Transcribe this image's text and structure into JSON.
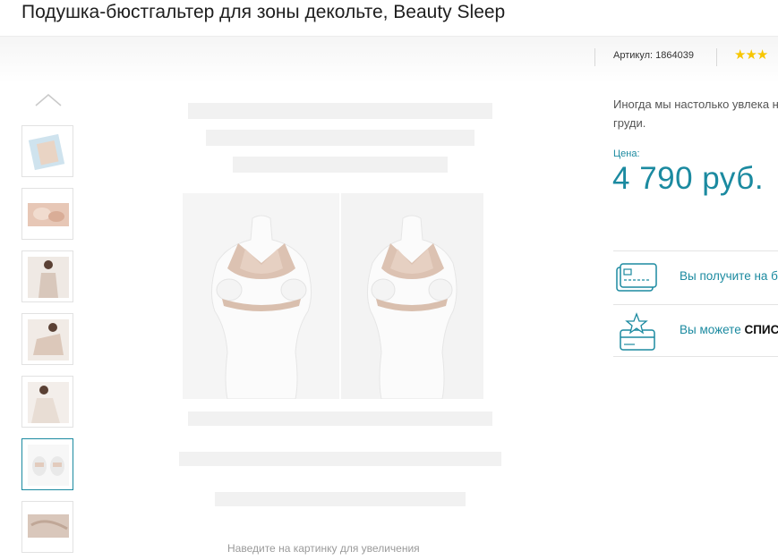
{
  "product": {
    "title": "Подушка-бюстгальтер для зоны декольте, Beauty Sleep",
    "article": "Артикул: 1864039",
    "rating_stars": "★★★"
  },
  "gallery": {
    "zoom_hint": "Наведите на картинку для увеличения",
    "thumbnails": [
      "thumb-package",
      "thumb-lifestyle-1",
      "thumb-model-1",
      "thumb-model-2",
      "thumb-model-3",
      "thumb-mannequins",
      "thumb-detail"
    ],
    "active_index": 5
  },
  "info": {
    "description": "Иногда мы настолько увлека на груди.",
    "price_label": "Цена:",
    "price": "4 790 руб."
  },
  "benefits": [
    {
      "icon": "card-icon",
      "text": "Вы получите на б"
    },
    {
      "icon": "star-card-icon",
      "text_prefix": "Вы можете ",
      "text_bold": "СПИС"
    }
  ],
  "colors": {
    "accent": "#1b8aa0",
    "star": "#f7c600"
  }
}
